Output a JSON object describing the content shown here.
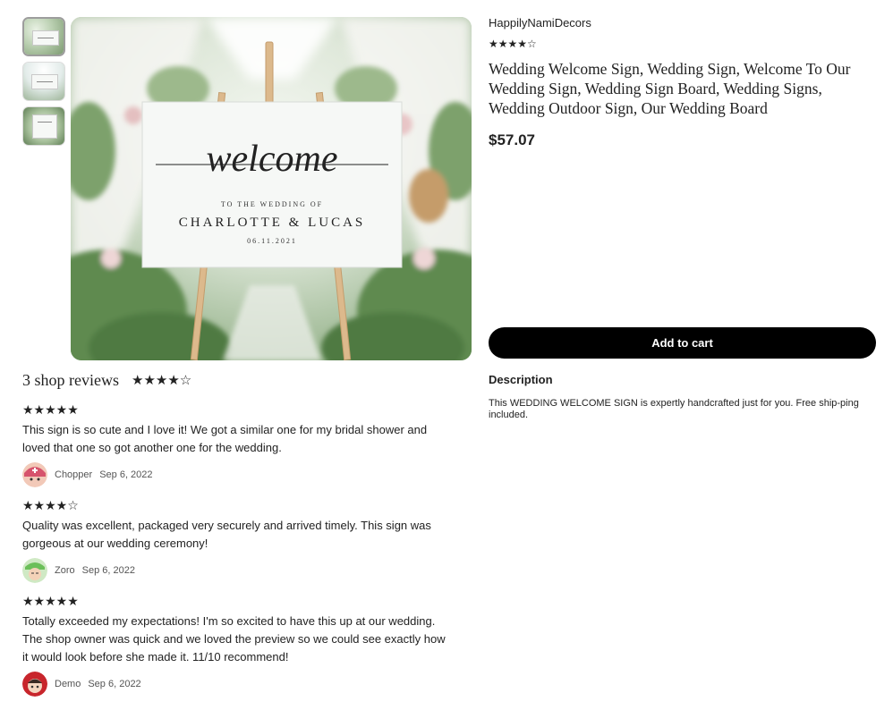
{
  "gallery": {
    "thumbnail_count": 3,
    "main_sign": {
      "script_word": "welcome",
      "line1": "TO THE WEDDING OF",
      "line2": "CHARLOTTE & LUCAS",
      "line3": "06.11.2021"
    }
  },
  "product": {
    "shop_name": "HappilyNamiDecors",
    "rating_stars": "★★★★☆",
    "title": "Wedding Welcome Sign, Wedding Sign, Welcome To Our Wedding Sign, Wedding Sign Board, Wedding Signs, Wedding Outdoor Sign, Our Wedding Board",
    "price": "$57.07",
    "add_to_cart": "Add to cart",
    "description_heading": "Description",
    "description_text": "This WEDDING WELCOME SIGN is expertly handcrafted just for you. Free ship-ping included."
  },
  "reviews": {
    "heading": "3 shop reviews",
    "stars": "★★★★☆",
    "items": [
      {
        "stars": "★★★★★",
        "text": "This sign is so cute and I love it! We got a similar one for my bridal shower and loved that one so got another one for the wedding.",
        "name": "Chopper",
        "date": "Sep 6, 2022"
      },
      {
        "stars": "★★★★☆",
        "text": "Quality was excellent, packaged very securely and arrived timely. This sign was gorgeous at our wedding ceremony!",
        "name": "Zoro",
        "date": "Sep 6, 2022"
      },
      {
        "stars": "★★★★★",
        "text": "Totally exceeded my expectations! I'm so excited to have this up at our wedding. The shop owner was quick and we loved the preview so we could see exactly how it would look before she made it. 11/10 recommend!",
        "name": "Demo",
        "date": "Sep 6, 2022"
      }
    ]
  },
  "colors": {
    "button_bg": "#000000",
    "button_text": "#ffffff",
    "text": "#222222"
  }
}
